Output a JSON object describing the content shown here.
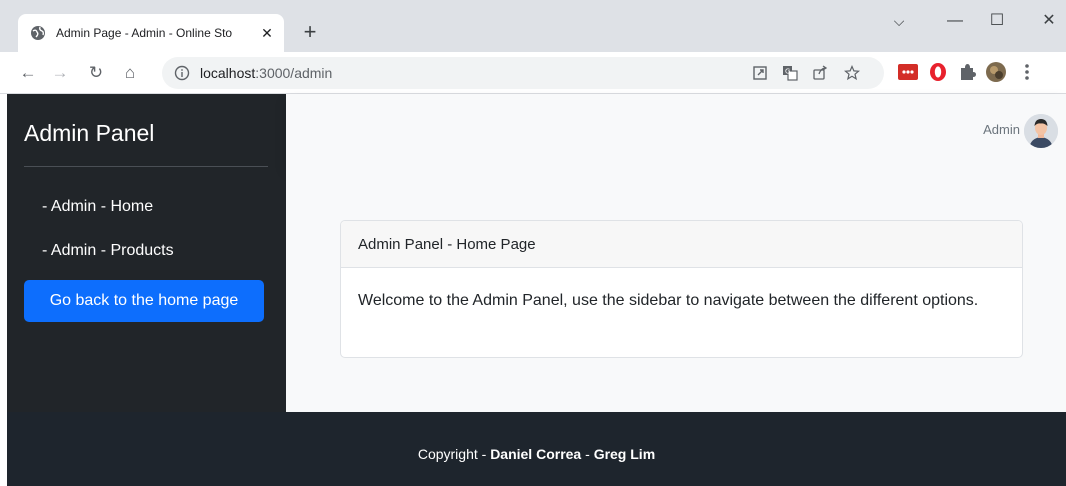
{
  "browser": {
    "tab_title": "Admin Page - Admin - Online Sto",
    "tab_close": "✕",
    "new_tab": "+",
    "url_host": "localhost",
    "url_path": ":3000/admin",
    "window_controls": {
      "minimize": "—",
      "maximize": "☐",
      "close": "✕",
      "dropdown": "⌵"
    },
    "nav": {
      "back": "←",
      "forward": "→",
      "reload": "↻",
      "home": "⌂"
    },
    "omnibox_icons": [
      "open-in-new-icon",
      "translate-icon",
      "share-icon",
      "bookmark-star-icon"
    ],
    "extension_icons": [
      "lastpass-icon",
      "opera-icon",
      "puzzle-extensions-icon",
      "profile-avatar-icon",
      "menu-kebab-icon"
    ]
  },
  "sidebar": {
    "title": "Admin Panel",
    "links": [
      "- Admin - Home",
      "- Admin - Products"
    ],
    "back_button": "Go back to the home page"
  },
  "topbar": {
    "user_label": "Admin"
  },
  "card": {
    "header": "Admin Panel - Home Page",
    "body": "Welcome to the Admin Panel, use the sidebar to navigate between the different options."
  },
  "footer": {
    "prefix": "Copyright - ",
    "author1": "Daniel Correa",
    "separator": " - ",
    "author2": "Greg Lim"
  },
  "colors": {
    "sidebar_bg": "#212529",
    "primary_button": "#0d6efd",
    "footer_bg": "#1e252d",
    "topbar_bg": "#f8f9fa"
  }
}
